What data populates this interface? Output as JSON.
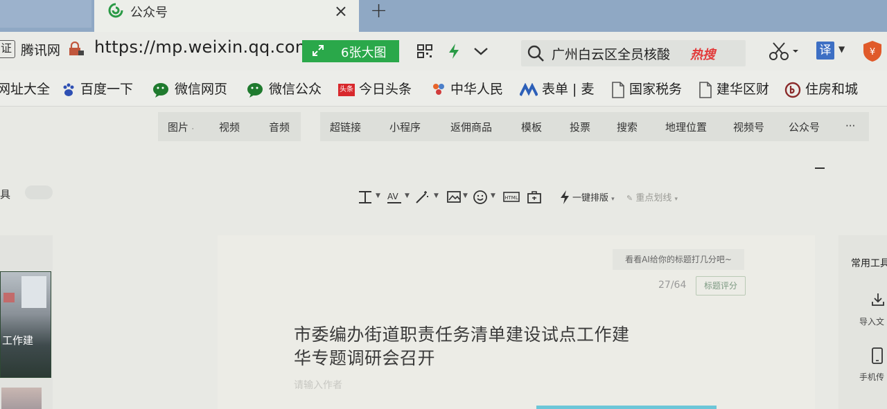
{
  "browser": {
    "tab": {
      "title": "公众号",
      "close": "×",
      "new_tab": "+"
    },
    "address": {
      "cert": "证",
      "site_name": "腾讯网",
      "url": "https://mp.weixin.qq.com/",
      "big_image_button": "6张大图"
    },
    "search": {
      "query": "广州白云区全员核酸",
      "hot_badge": "热搜"
    },
    "translate_label": "译"
  },
  "bookmarks": [
    "网址大全",
    "百度一下",
    "微信网页",
    "微信公众",
    "今日头条",
    "中华人民",
    "表单 | 麦",
    "国家税务",
    "建华区财",
    "住房和城"
  ],
  "bookmark_badges": {
    "toutiao": "头条"
  },
  "editor": {
    "media_tools": [
      "图片",
      "视频",
      "音频"
    ],
    "insert_tools": [
      "超链接",
      "小程序",
      "返佣商品",
      "模板",
      "投票",
      "搜索",
      "地理位置",
      "视频号",
      "公众号",
      "···"
    ],
    "sidebar_fragment": "具",
    "format_tools": {
      "one_click_layout": "一键排版",
      "highlight": "重点划线"
    },
    "ai_tip": "看看AI给你的标题打几分吧~",
    "title_counter": "27/64",
    "title_score_button": "标题评分",
    "title_lines": [
      "市委编办街道职责任务清单建设试点工作建",
      "华专题调研会召开"
    ],
    "author_placeholder": "请输入作者",
    "thumbnail_caption": "工作建"
  },
  "right_panel": {
    "title": "常用工具",
    "import_label": "导入文",
    "phone_label": "手机传"
  }
}
